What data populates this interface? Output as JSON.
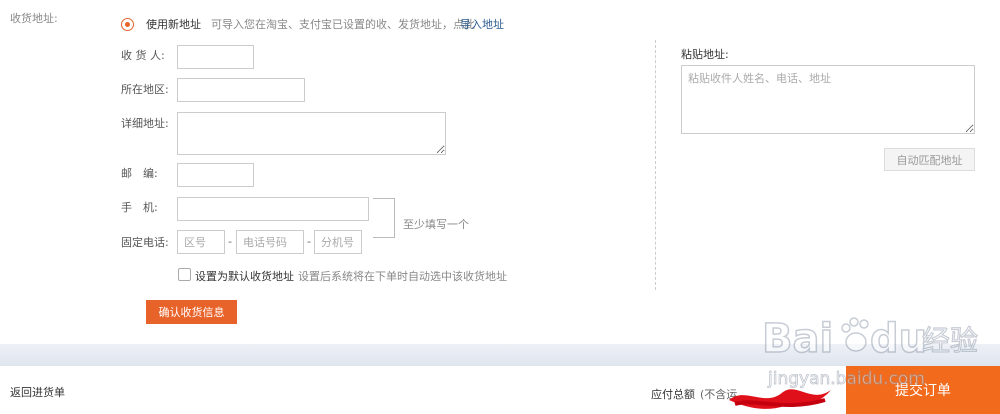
{
  "section": {
    "label": "收货地址:"
  },
  "address_option": {
    "use_new_label": "使用新地址",
    "hint": "可导入您在淘宝、支付宝已设置的收、发货地址，点此",
    "import_link": "导入地址"
  },
  "form": {
    "receiver_label": "收 货 人:",
    "region_label": "所在地区:",
    "detail_label": "详细地址:",
    "postcode_label": "邮　编:",
    "mobile_label": "手　机:",
    "phone_label": "固定电话:",
    "area_code_placeholder": "区号",
    "phone_number_placeholder": "电话号码",
    "ext_placeholder": "分机号",
    "dash": "-",
    "at_least_one": "至少填写一个",
    "default_label": "设置为默认收货地址",
    "default_hint": "设置后系统将在下单时自动选中该收货地址",
    "confirm_button": "确认收货信息"
  },
  "paste": {
    "title": "粘贴地址:",
    "placeholder": "粘贴收件人姓名、电话、地址",
    "auto_match_button": "自动匹配地址"
  },
  "footer": {
    "back_link": "返回进货单",
    "total_label": "应付总额",
    "total_note": "(不含运",
    "submit_button": "提交订单"
  },
  "watermark": {
    "brand": "Bai",
    "brand2": "du",
    "cn": "经验",
    "url": "jingyan.baidu.com"
  },
  "colors": {
    "accent": "#e8632a",
    "submit": "#f26a1c",
    "link": "#2a5b8f",
    "scribble": "#e0101a"
  }
}
